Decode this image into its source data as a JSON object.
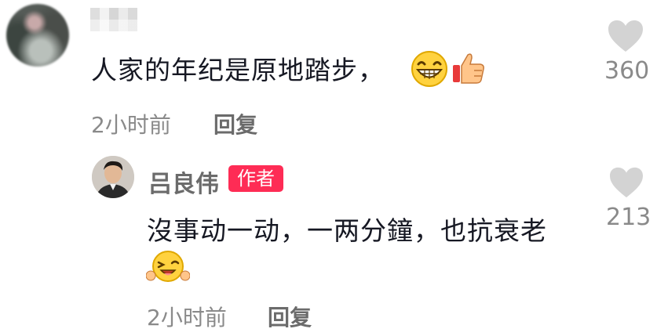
{
  "comment1": {
    "text": "人家的年纪是原地踏步，",
    "time": "2小时前",
    "reply_label": "回复",
    "like_count": "360",
    "emojis": [
      "grin-emoji",
      "thumbs-up-emoji"
    ]
  },
  "comment2": {
    "username": "吕良伟",
    "badge": "作者",
    "text": "沒事动一动，一两分鐘，也抗衰老",
    "time": "2小时前",
    "reply_label": "回复",
    "like_count": "213",
    "emojis": [
      "wink-emoji"
    ]
  },
  "colors": {
    "badge_bg": "#fe2c55",
    "text_primary": "#161823",
    "text_secondary": "#8a8a8a",
    "heart": "#d3d3d3"
  }
}
